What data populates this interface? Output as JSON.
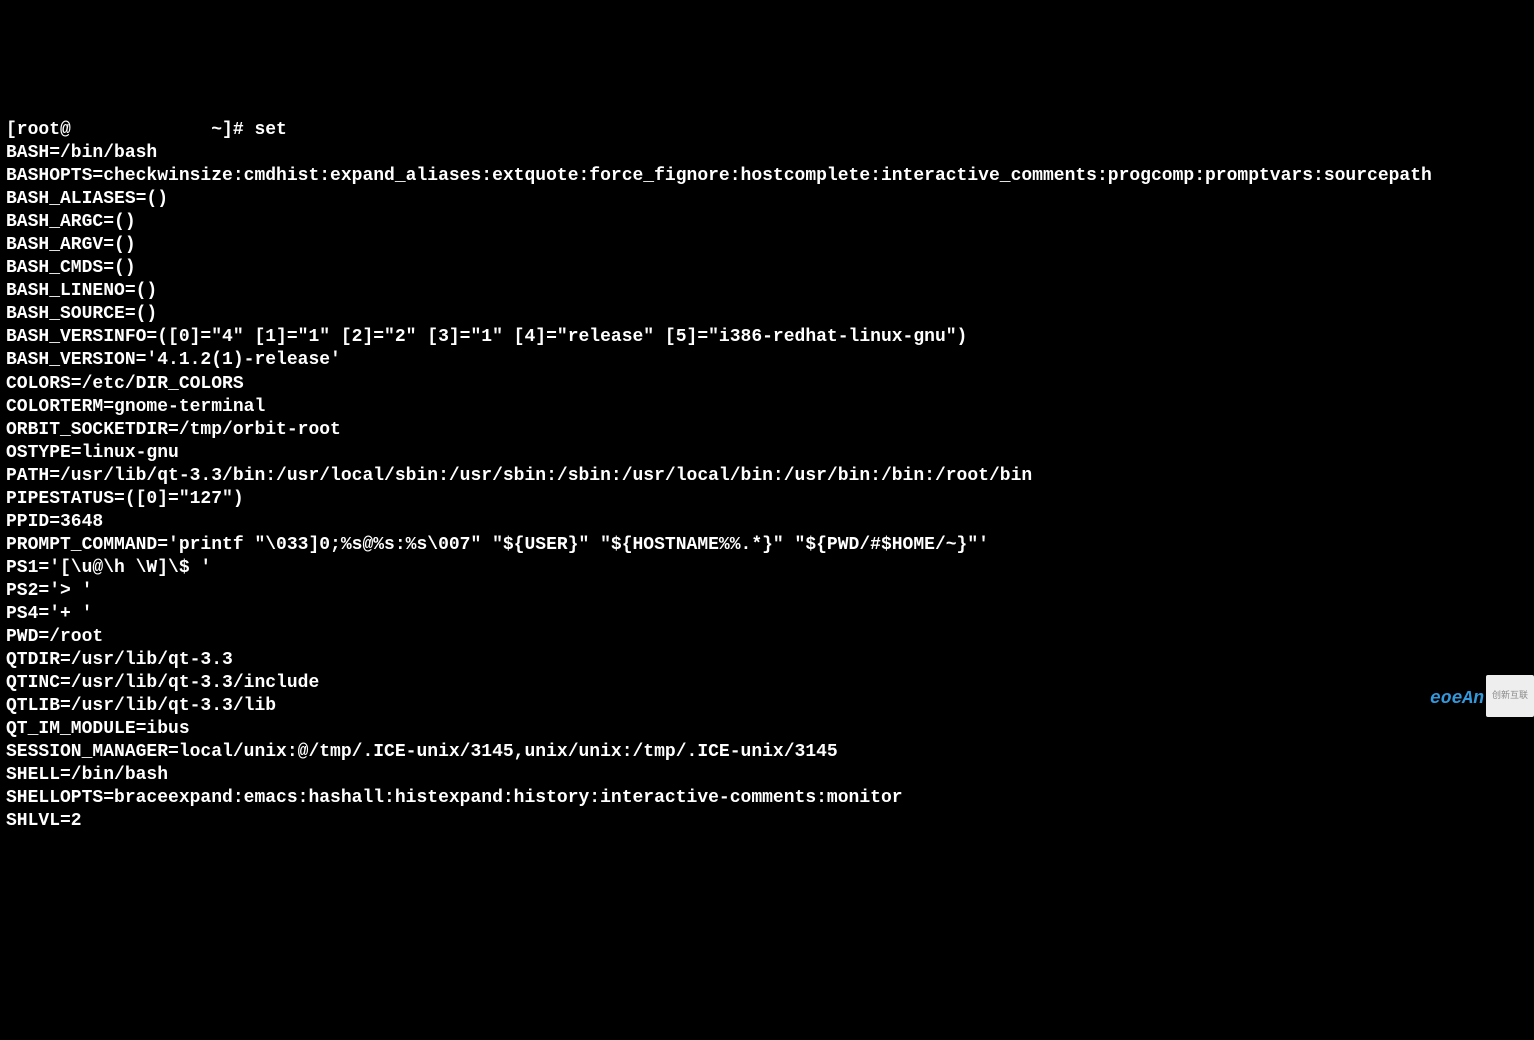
{
  "prompt": "[root@             ~]# set",
  "lines": [
    "BASH=/bin/bash",
    "BASHOPTS=checkwinsize:cmdhist:expand_aliases:extquote:force_fignore:hostcomplete:interactive_comments:progcomp:promptvars:sourcepath",
    "BASH_ALIASES=()",
    "BASH_ARGC=()",
    "BASH_ARGV=()",
    "BASH_CMDS=()",
    "BASH_LINENO=()",
    "BASH_SOURCE=()",
    "BASH_VERSINFO=([0]=\"4\" [1]=\"1\" [2]=\"2\" [3]=\"1\" [4]=\"release\" [5]=\"i386-redhat-linux-gnu\")",
    "BASH_VERSION='4.1.2(1)-release'",
    "COLORS=/etc/DIR_COLORS",
    "COLORTERM=gnome-terminal",
    "ORBIT_SOCKETDIR=/tmp/orbit-root",
    "OSTYPE=linux-gnu",
    "PATH=/usr/lib/qt-3.3/bin:/usr/local/sbin:/usr/sbin:/sbin:/usr/local/bin:/usr/bin:/bin:/root/bin",
    "PIPESTATUS=([0]=\"127\")",
    "PPID=3648",
    "PROMPT_COMMAND='printf \"\\033]0;%s@%s:%s\\007\" \"${USER}\" \"${HOSTNAME%%.*}\" \"${PWD/#$HOME/~}\"'",
    "PS1='[\\u@\\h \\W]\\$ '",
    "PS2='> '",
    "PS4='+ '",
    "PWD=/root",
    "QTDIR=/usr/lib/qt-3.3",
    "QTINC=/usr/lib/qt-3.3/include",
    "QTLIB=/usr/lib/qt-3.3/lib",
    "QT_IM_MODULE=ibus",
    "SESSION_MANAGER=local/unix:@/tmp/.ICE-unix/3145,unix/unix:/tmp/.ICE-unix/3145",
    "SHELL=/bin/bash",
    "SHELLOPTS=braceexpand:emacs:hashall:histexpand:history:interactive-comments:monitor",
    "SHLVL=2"
  ],
  "watermark_text": "eoeAn",
  "watermark_logo": "创新互联"
}
